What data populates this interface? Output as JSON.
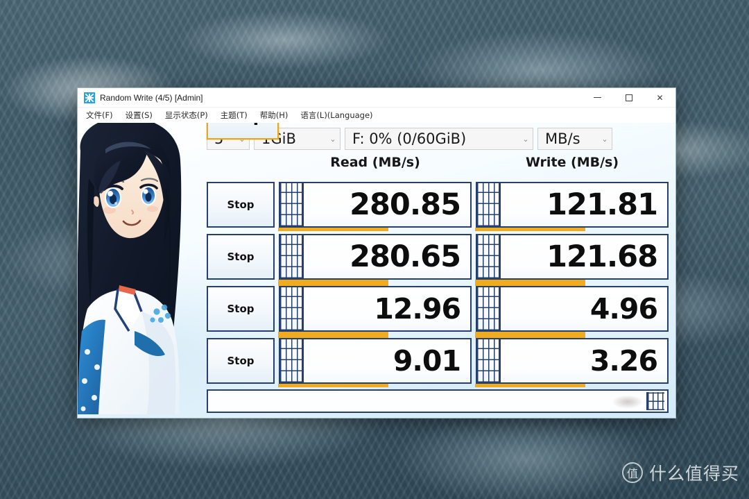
{
  "desktop": {
    "wallpaper_description": "sea-water-waves",
    "watermark": {
      "badge_glyph": "值",
      "text": "什么值得买"
    }
  },
  "window": {
    "title": "Random Write (4/5) [Admin]",
    "icon_name": "crystaldiskmark-icon",
    "controls": {
      "minimize": "−",
      "maximize": "□",
      "close": "✕"
    }
  },
  "menubar": {
    "items": [
      {
        "label": "文件(F)"
      },
      {
        "label": "设置(S)"
      },
      {
        "label": "显示状态(P)"
      },
      {
        "label": "主题(T)"
      },
      {
        "label": "帮助(H)"
      },
      {
        "label": "语言(L)(Language)"
      }
    ]
  },
  "toolbar": {
    "all_button_label": "Stop",
    "test_count": "5",
    "test_size": "1GiB",
    "target_drive": "F: 0% (0/60GiB)",
    "unit": "MB/s",
    "chevron": "⌄"
  },
  "headers": {
    "read": "Read (MB/s)",
    "write": "Write (MB/s)"
  },
  "results": {
    "rows": [
      {
        "button_label": "Stop",
        "read": "280.85",
        "write": "121.81"
      },
      {
        "button_label": "Stop",
        "read": "280.65",
        "write": "121.68"
      },
      {
        "button_label": "Stop",
        "read": "12.96",
        "write": "4.96"
      },
      {
        "button_label": "Stop",
        "read": "9.01",
        "write": "3.26"
      }
    ]
  },
  "statusbar": {
    "text": ""
  },
  "colors": {
    "accent_gold": "#f0ab1f",
    "frame_navy": "#27406b",
    "title_icon_blue": "#29a3e8"
  }
}
